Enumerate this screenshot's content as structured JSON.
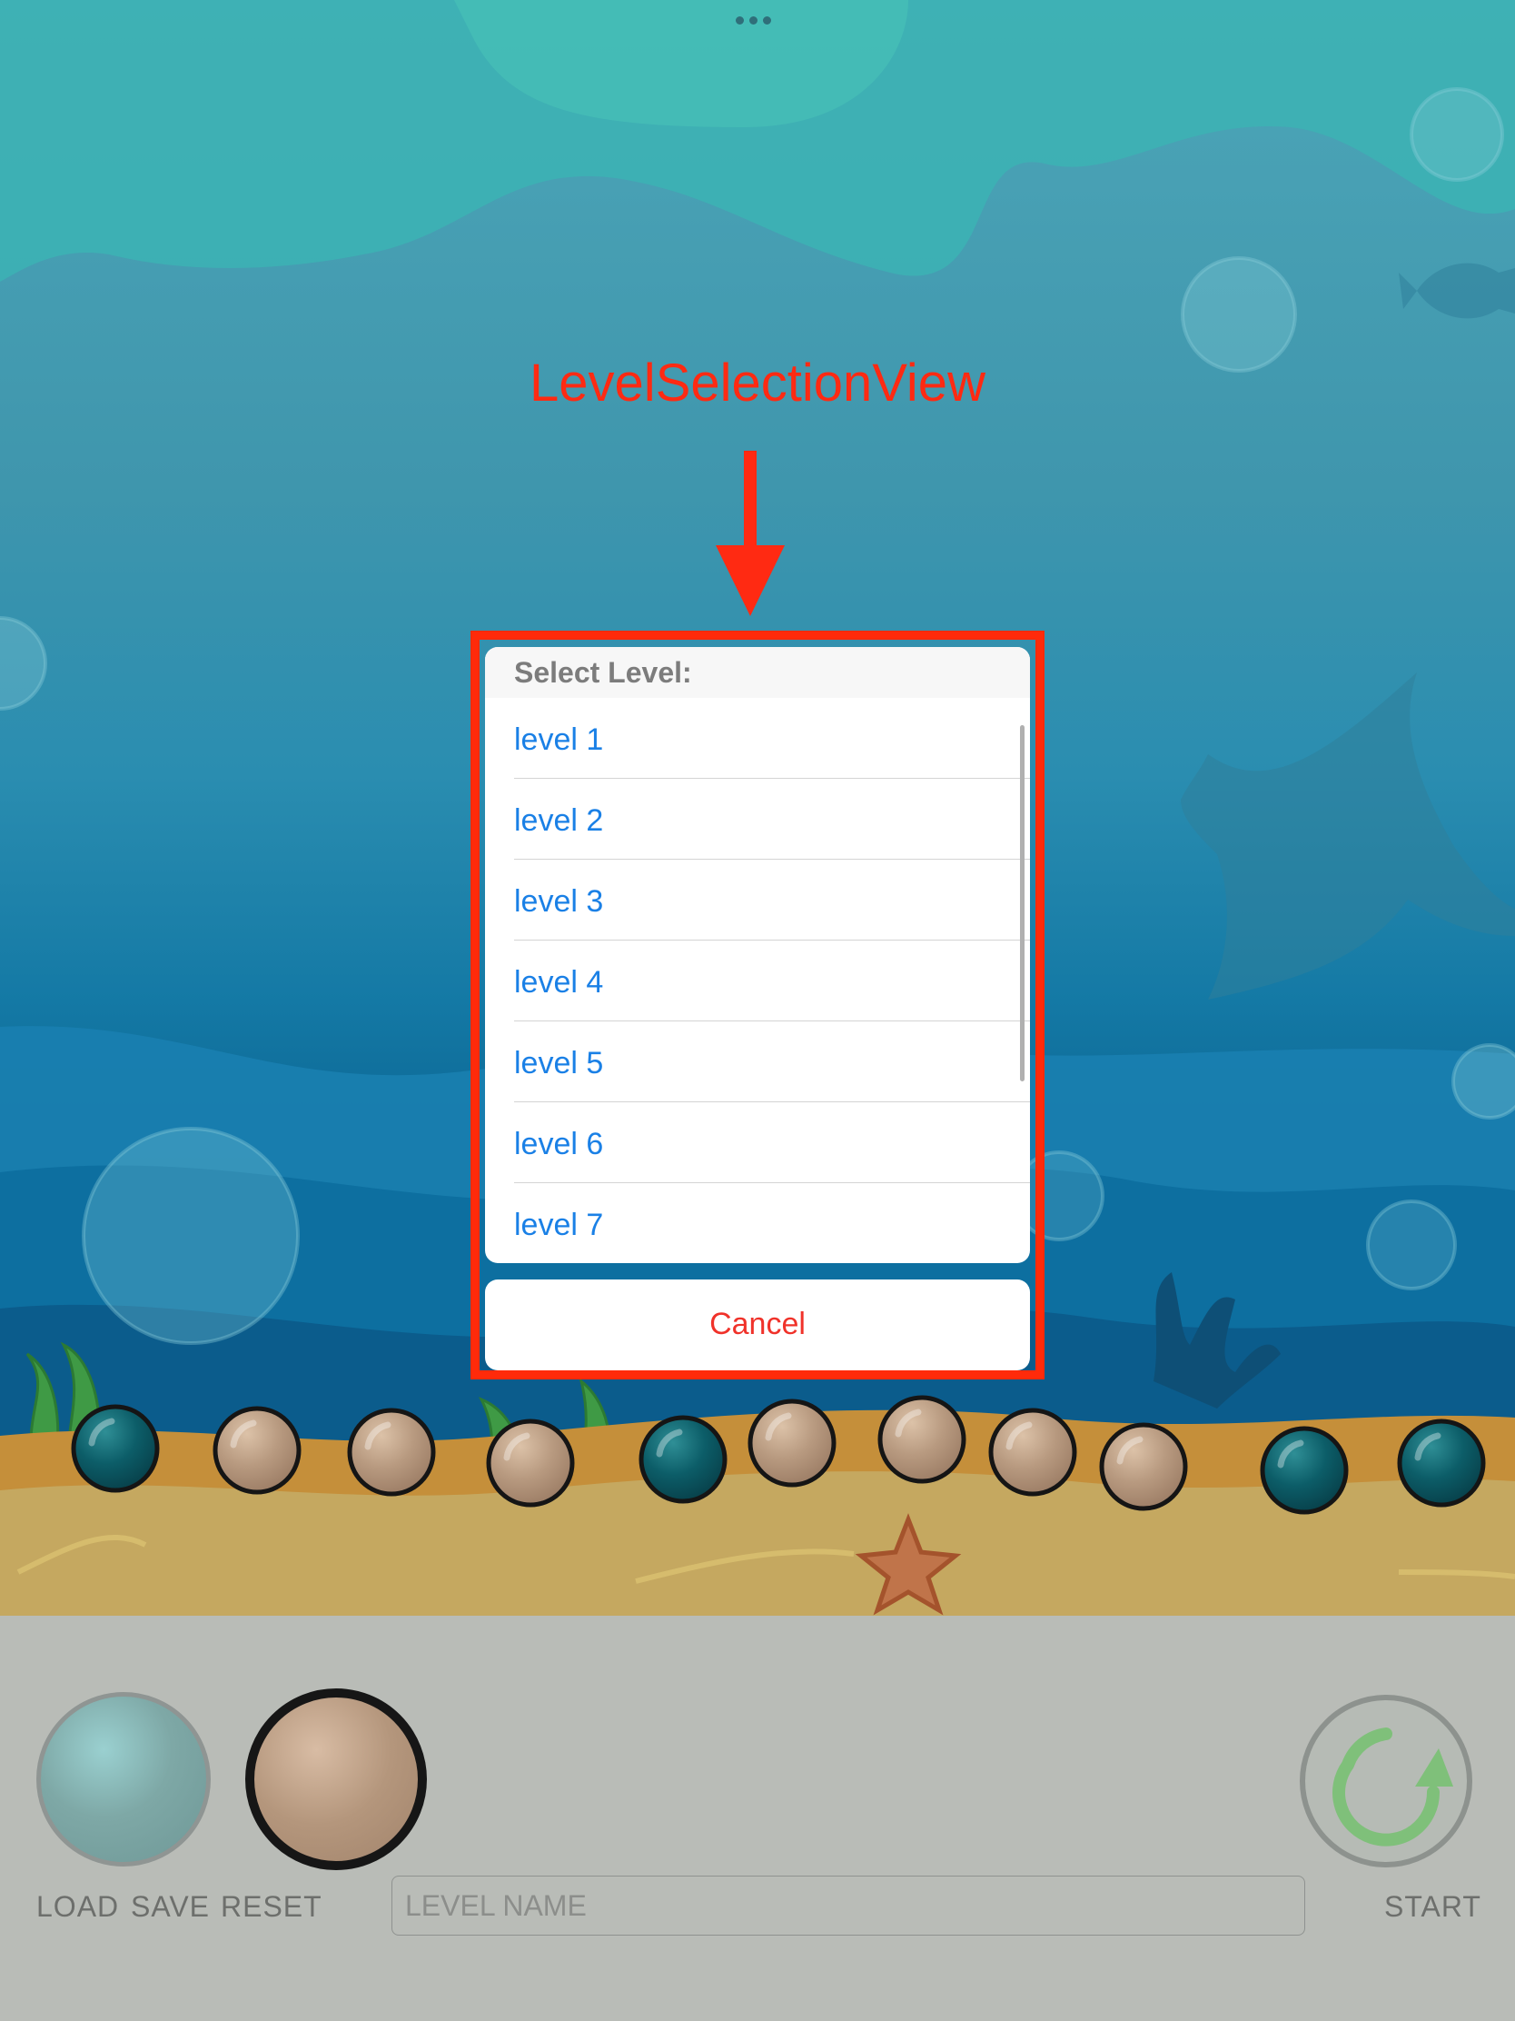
{
  "annotation": {
    "label": "LevelSelectionView"
  },
  "level_selection": {
    "title": "Select Level:",
    "levels": [
      "level 1",
      "level 2",
      "level 3",
      "level 4",
      "level 5",
      "level 6",
      "level 7"
    ],
    "cancel_label": "Cancel"
  },
  "toolbar": {
    "load_label": "LOAD",
    "save_label": "SAVE",
    "reset_label": "RESET",
    "start_label": "START",
    "level_name_placeholder": "LEVEL NAME",
    "level_name_value": ""
  },
  "palette": {
    "selected": "beige",
    "options": [
      "blue",
      "beige"
    ]
  },
  "bubbles_row": [
    "blue",
    "beige",
    "beige",
    "beige",
    "blue",
    "beige",
    "beige",
    "beige",
    "beige",
    "blue",
    "blue"
  ],
  "colors": {
    "accent_red": "#ff2a12",
    "link_blue": "#1a80e6",
    "cancel_red": "#f0322a",
    "bubble_blue": "#0c5d68",
    "bubble_beige": "#b89a80",
    "toolbar_bg": "#b9bcb7"
  },
  "icons": {
    "start": "restart-arrow-icon",
    "menu": "multitasking-dots-icon"
  }
}
